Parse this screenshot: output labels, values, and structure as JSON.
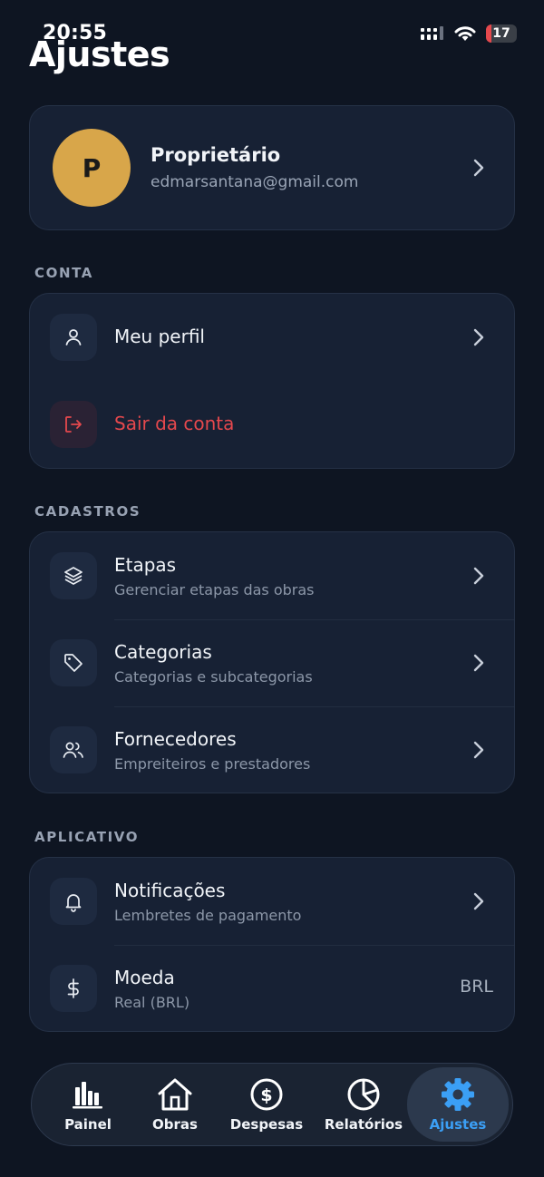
{
  "status_bar": {
    "time": "20:55",
    "battery": "17",
    "battery_level": 0.17
  },
  "header": {
    "title": "Ajustes"
  },
  "profile": {
    "initial": "P",
    "name": "Proprietário",
    "email": "edmarsantana@gmail.com"
  },
  "sections": {
    "conta": {
      "label": "CONTA",
      "items": [
        {
          "title": "Meu perfil",
          "icon": "user-icon"
        },
        {
          "title": "Sair da conta",
          "icon": "logout-icon"
        }
      ]
    },
    "cadastros": {
      "label": "CADASTROS",
      "items": [
        {
          "title": "Etapas",
          "subtitle": "Gerenciar etapas das obras",
          "icon": "layers-icon"
        },
        {
          "title": "Categorias",
          "subtitle": "Categorias e subcategorias",
          "icon": "tag-icon"
        },
        {
          "title": "Fornecedores",
          "subtitle": "Empreiteiros e prestadores",
          "icon": "users-icon"
        }
      ]
    },
    "aplicativo": {
      "label": "APLICATIVO",
      "items": [
        {
          "title": "Notificações",
          "subtitle": "Lembretes de pagamento",
          "icon": "bell-icon"
        },
        {
          "title": "Moeda",
          "subtitle": "Real (BRL)",
          "value": "BRL",
          "icon": "dollar-icon"
        }
      ]
    }
  },
  "tabbar": {
    "tabs": [
      {
        "label": "Painel",
        "icon": "bar-chart-icon"
      },
      {
        "label": "Obras",
        "icon": "house-icon"
      },
      {
        "label": "Despesas",
        "icon": "dollar-circle-icon"
      },
      {
        "label": "Relatórios",
        "icon": "pie-chart-icon"
      },
      {
        "label": "Ajustes",
        "icon": "gear-icon",
        "active": true
      }
    ]
  },
  "colors": {
    "background": "#0e1522",
    "card": "#172134",
    "accent": "#3b9ff5",
    "danger": "#e5484d",
    "avatar": "#d8a64a"
  }
}
